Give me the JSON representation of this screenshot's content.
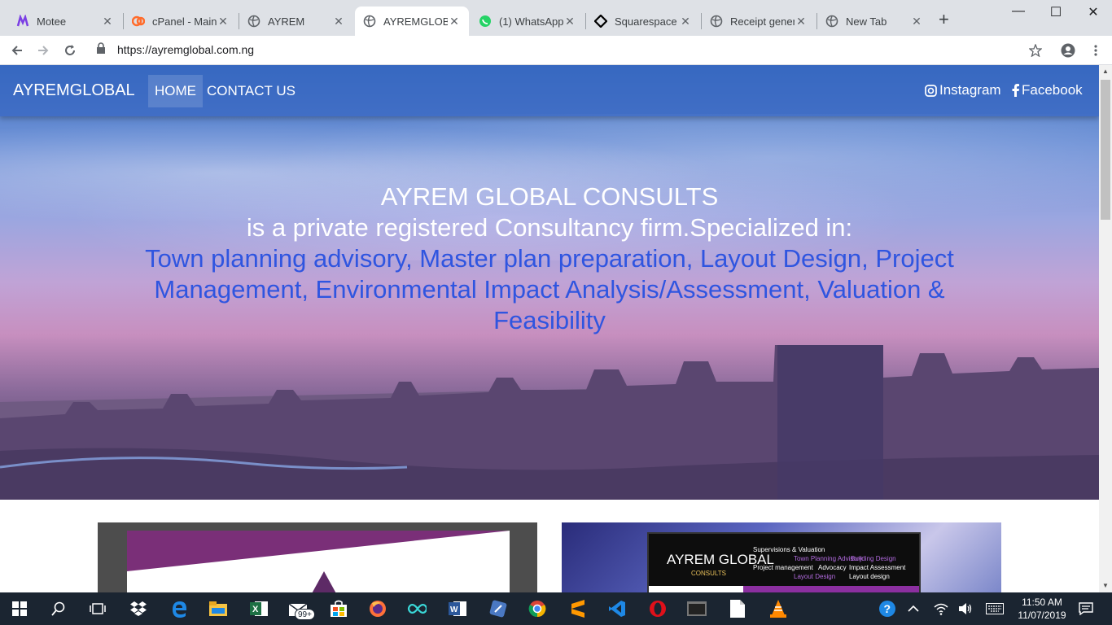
{
  "browser": {
    "tabs": [
      {
        "title": "Motee",
        "icon": "motee-icon",
        "color": "#7b3fe4"
      },
      {
        "title": "cPanel - Main",
        "icon": "cpanel-icon",
        "color": "#ff6c2c"
      },
      {
        "title": "AYREM",
        "icon": "globe-icon",
        "color": "#5f6368"
      },
      {
        "title": "AYREMGLOBAL",
        "icon": "globe-icon",
        "color": "#5f6368"
      },
      {
        "title": "(1) WhatsApp",
        "icon": "whatsapp-icon",
        "color": "#25d366"
      },
      {
        "title": "Squarespace E",
        "icon": "squarespace-icon",
        "color": "#000000"
      },
      {
        "title": "Receipt genera",
        "icon": "globe-icon",
        "color": "#5f6368"
      },
      {
        "title": "New Tab",
        "icon": "globe-icon",
        "color": "#5f6368"
      }
    ],
    "active_tab": 3,
    "new_tab_label": "+",
    "window_controls": {
      "minimize": "—",
      "maximize": "☐",
      "close": "✕"
    },
    "url": "https://ayremglobal.com.ng"
  },
  "site": {
    "brand": "AYREMGLOBAL",
    "nav": [
      {
        "label": "HOME",
        "active": true
      },
      {
        "label": "CONTACT US",
        "active": false
      }
    ],
    "social": [
      {
        "label": "Instagram",
        "icon": "instagram-icon"
      },
      {
        "label": "Facebook",
        "icon": "facebook-icon"
      }
    ],
    "hero": {
      "title": "AYREM GLOBAL CONSULTS",
      "subtitle": "is a private registered Consultancy firm.Specialized in:",
      "services": "Town planning advisory, Master plan preparation, Layout Design, Project Management, Environmental Impact Analysis/Assessment, Valuation & Feasibility"
    },
    "card2": {
      "title": "AYREM GLOBAL",
      "subtitle": "CONSULTS",
      "bullets": [
        "Supervisions & Valuation",
        "Town Planning Advisory",
        "Building Design",
        "Project management",
        "Advocacy",
        "Impact Assessment",
        "Layout Design",
        "Layout design"
      ]
    }
  },
  "taskbar": {
    "badge": "99+",
    "time": "11:50 AM",
    "date": "11/07/2019",
    "icons": [
      "windows-start-icon",
      "search-icon",
      "task-view-icon",
      "dropbox-icon",
      "edge-icon",
      "file-explorer-icon",
      "excel-icon",
      "mail-icon",
      "store-icon",
      "firefox-icon",
      "infinity-icon",
      "word-icon",
      "app-icon",
      "chrome-icon",
      "sublime-icon",
      "vscode-icon",
      "opera-icon",
      "terminal-icon",
      "notepad-icon",
      "vlc-icon"
    ]
  }
}
